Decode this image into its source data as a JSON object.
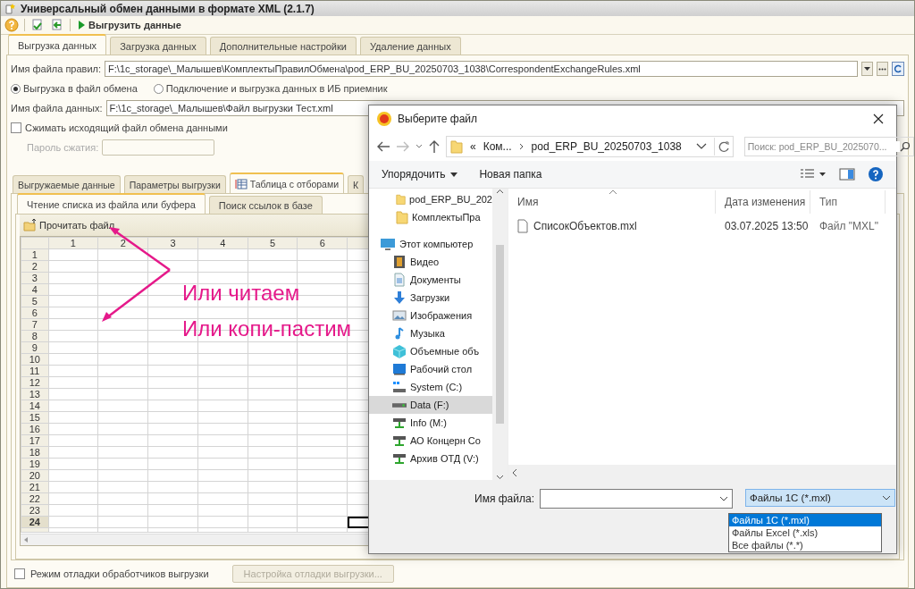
{
  "window": {
    "title": "Универсальный обмен данными в формате XML (2.1.7)"
  },
  "toolbar": {
    "action": "Выгрузить данные"
  },
  "tabs": [
    {
      "label": "Выгрузка данных",
      "selected": true
    },
    {
      "label": "Загрузка данных",
      "selected": false
    },
    {
      "label": "Дополнительные настройки",
      "selected": false
    },
    {
      "label": "Удаление данных",
      "selected": false
    }
  ],
  "rules_file": {
    "label": "Имя файла правил:",
    "value": "F:\\1c_storage\\_Малышев\\КомплектыПравилОбмена\\pod_ERP_BU_20250703_1038\\CorrespondentExchangeRules.xml"
  },
  "export_mode": [
    {
      "label": "Выгрузка в файл обмена",
      "selected": true
    },
    {
      "label": "Подключение и выгрузка данных в ИБ приемник",
      "selected": false
    }
  ],
  "data_file": {
    "label": "Имя файла данных:",
    "value": "F:\\1c_storage\\_Малышев\\Файл выгрузки Тест.xml"
  },
  "compress": {
    "label": "Сжимать исходящий файл обмена данными",
    "checked": false
  },
  "password": {
    "label": "Пароль сжатия:",
    "disabled": true
  },
  "inner_tabs": [
    {
      "label": "Выгружаемые данные",
      "selected": false
    },
    {
      "label": "Параметры выгрузки",
      "selected": false
    },
    {
      "label": "Таблица с отборами",
      "selected": true
    },
    {
      "label": "К",
      "selected": false
    }
  ],
  "sub_tabs": [
    {
      "label": "Чтение списка из файла или буфера",
      "selected": true
    },
    {
      "label": "Поиск ссылок в базе",
      "selected": false
    }
  ],
  "read_button": "Прочитать файл",
  "grid": {
    "columns": [
      "1",
      "2",
      "3",
      "4",
      "5",
      "6"
    ],
    "rows": [
      {
        "label": "1",
        "selected": false
      },
      {
        "label": "2",
        "selected": false
      },
      {
        "label": "3",
        "selected": false
      },
      {
        "label": "4",
        "selected": false
      },
      {
        "label": "5",
        "selected": false
      },
      {
        "label": "6",
        "selected": false
      },
      {
        "label": "7",
        "selected": false
      },
      {
        "label": "8",
        "selected": false
      },
      {
        "label": "9",
        "selected": false
      },
      {
        "label": "10",
        "selected": false
      },
      {
        "label": "11",
        "selected": false
      },
      {
        "label": "12",
        "selected": false
      },
      {
        "label": "13",
        "selected": false
      },
      {
        "label": "14",
        "selected": false
      },
      {
        "label": "15",
        "selected": false
      },
      {
        "label": "16",
        "selected": false
      },
      {
        "label": "17",
        "selected": false
      },
      {
        "label": "18",
        "selected": false
      },
      {
        "label": "19",
        "selected": false
      },
      {
        "label": "20",
        "selected": false
      },
      {
        "label": "21",
        "selected": false
      },
      {
        "label": "22",
        "selected": false
      },
      {
        "label": "23",
        "selected": false
      },
      {
        "label": "24",
        "selected": true
      }
    ]
  },
  "debug_mode": {
    "label": "Режим отладки обработчиков выгрузки",
    "checked": false
  },
  "debug_settings_button": {
    "label": "Настройка отладки выгрузки...",
    "disabled": true
  },
  "annotations": [
    "Или читаем",
    "Или копи-пастим"
  ],
  "dialog": {
    "title": "Выберите файл",
    "path_overflow": "«",
    "path": [
      "Ком...",
      "pod_ERP_BU_20250703_1038"
    ],
    "search": {
      "placeholder": "Поиск: pod_ERP_BU_2025070..."
    },
    "commands": [
      "Упорядочить",
      "Новая папка"
    ],
    "nav": [
      {
        "label": "pod_ERP_BU_202",
        "kind": "folder",
        "selected": false
      },
      {
        "label": "КомплектыПра",
        "kind": "folder",
        "selected": false
      },
      {
        "label": "Этот компьютер",
        "kind": "computer",
        "selected": false,
        "children": [
          {
            "label": "Видео",
            "kind": "video",
            "selected": false
          },
          {
            "label": "Документы",
            "kind": "documents",
            "selected": false
          },
          {
            "label": "Загрузки",
            "kind": "downloads",
            "selected": false
          },
          {
            "label": "Изображения",
            "kind": "images",
            "selected": false
          },
          {
            "label": "Музыка",
            "kind": "music",
            "selected": false
          },
          {
            "label": "Объемные объ",
            "kind": "objects",
            "selected": false
          },
          {
            "label": "Рабочий стол",
            "kind": "desktop",
            "selected": false
          },
          {
            "label": "System (C:)",
            "kind": "system-drive",
            "selected": false
          },
          {
            "label": "Data (F:)",
            "kind": "drive",
            "selected": true
          },
          {
            "label": "Info (M:)",
            "kind": "network-drive",
            "selected": false
          },
          {
            "label": "АО Концерн Со",
            "kind": "network-drive",
            "selected": false
          },
          {
            "label": "Архив ОТД (V:)",
            "kind": "network-drive",
            "selected": false
          }
        ]
      }
    ],
    "columns": [
      "Имя",
      "Дата изменения",
      "Тип"
    ],
    "files": [
      {
        "name": "СписокОбъектов.mxl",
        "modified": "03.07.2025 13:50",
        "type": "Файл \"MXL\""
      }
    ],
    "file_name": {
      "label": "Имя файла:"
    },
    "filter": {
      "value": "Файлы 1С (*.mxl)",
      "options": [
        {
          "label": "Файлы 1С (*.mxl)",
          "selected": true
        },
        {
          "label": "Файлы Excel (*.xls)",
          "selected": false
        },
        {
          "label": "Все файлы (*.*)",
          "selected": false
        }
      ]
    }
  }
}
